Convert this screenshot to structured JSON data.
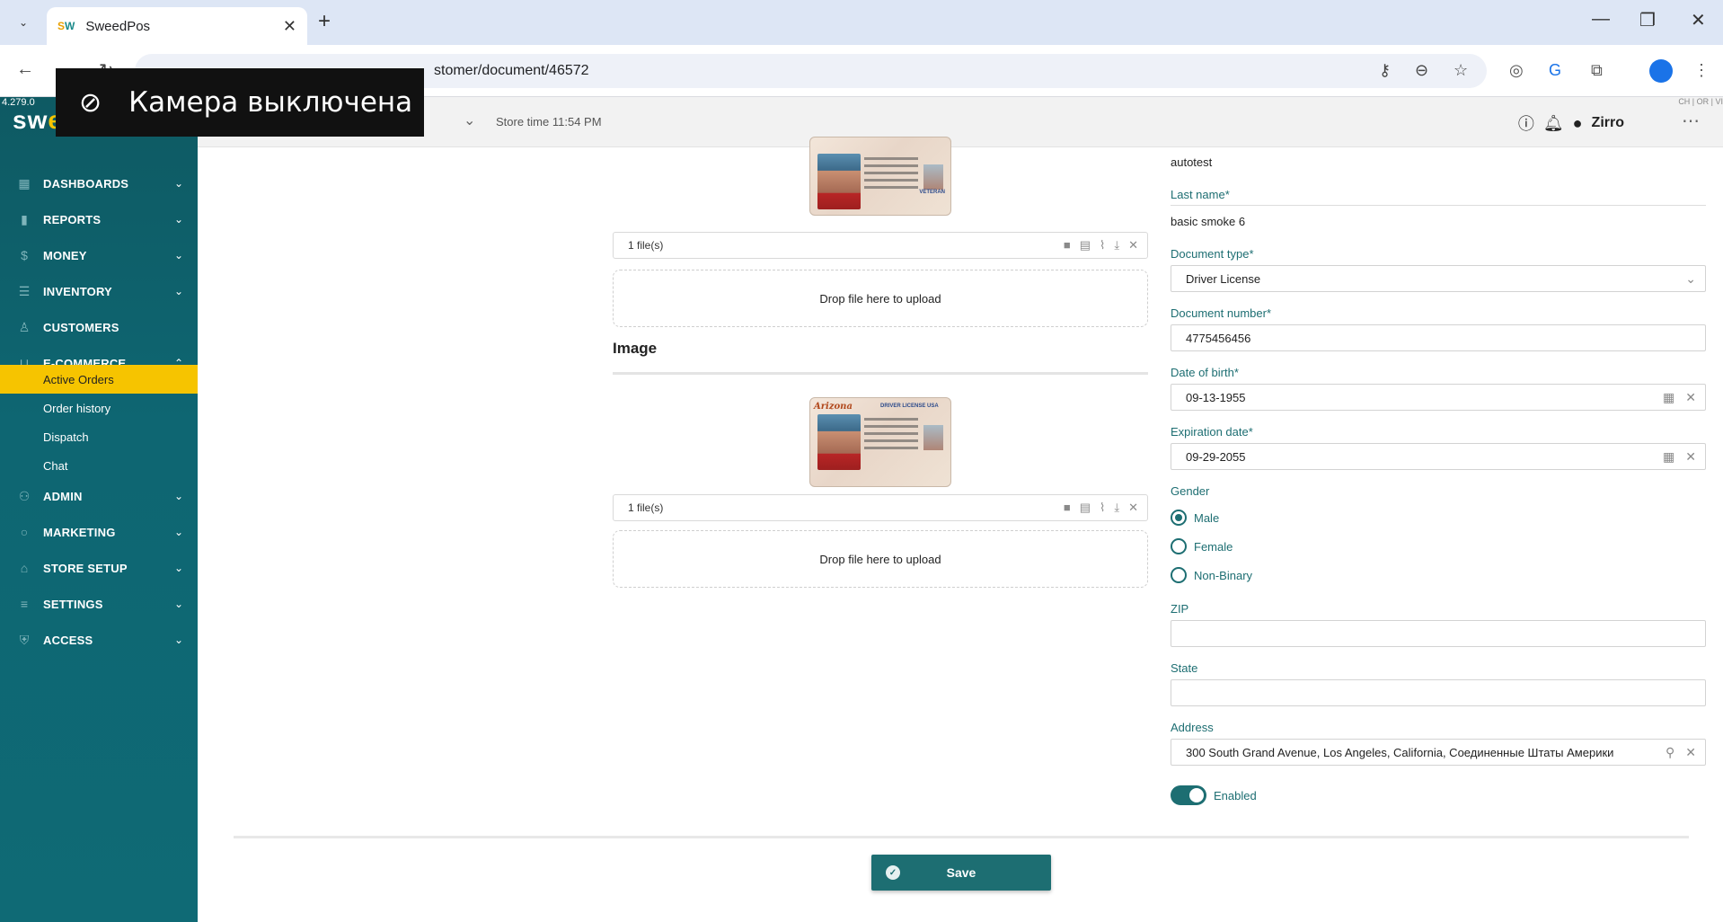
{
  "browser": {
    "tab_title": "SweedPos",
    "tab_favicon": "SW",
    "url": "stomer/document/46572",
    "camera_overlay": "Камера выключена"
  },
  "app": {
    "version": "4.279.0",
    "corner_tag": "CH | OR | VI",
    "logo": "sweed",
    "store_time": "Store time 11:54 PM",
    "user_name": "Zirro"
  },
  "sidebar": {
    "items": [
      {
        "label": "DASHBOARDS",
        "icon": "grid-icon"
      },
      {
        "label": "REPORTS",
        "icon": "bar-chart-icon"
      },
      {
        "label": "MONEY",
        "icon": "dollar-icon"
      },
      {
        "label": "INVENTORY",
        "icon": "list-icon"
      },
      {
        "label": "CUSTOMERS",
        "icon": "person-icon"
      },
      {
        "label": "E-COMMERCE",
        "icon": "basket-icon"
      },
      {
        "label": "ADMIN",
        "icon": "users-icon"
      },
      {
        "label": "MARKETING",
        "icon": "search-icon"
      },
      {
        "label": "STORE SETUP",
        "icon": "home-icon"
      },
      {
        "label": "SETTINGS",
        "icon": "sliders-icon"
      },
      {
        "label": "ACCESS",
        "icon": "shield-icon"
      }
    ],
    "ecommerce_sub": [
      {
        "label": "Active Orders"
      },
      {
        "label": "Order history"
      },
      {
        "label": "Dispatch"
      },
      {
        "label": "Chat"
      }
    ]
  },
  "images": {
    "card1_file_count": "1 file(s)",
    "card1_drop": "Drop file here to upload",
    "section_title": "Image",
    "card2_file_count": "1 file(s)",
    "card2_drop": "Drop file here to upload",
    "license_state": "Arizona",
    "license_type": "DRIVER LICENSE  USA",
    "license_veteran": "VETERAN"
  },
  "form": {
    "first_name_value": "autotest",
    "last_name_label": "Last name",
    "last_name_value": "basic smoke 6",
    "doc_type_label": "Document type",
    "doc_type_value": "Driver License",
    "doc_number_label": "Document number",
    "doc_number_value": "4775456456",
    "dob_label": "Date of birth",
    "dob_value": "09-13-1955",
    "exp_label": "Expiration date",
    "exp_value": "09-29-2055",
    "gender_label": "Gender",
    "gender_options": [
      "Male",
      "Female",
      "Non-Binary"
    ],
    "gender_selected": "Male",
    "zip_label": "ZIP",
    "zip_value": "",
    "state_label": "State",
    "state_value": "",
    "address_label": "Address",
    "address_value": "300 South Grand Avenue, Los Angeles, California, Соединенные Штаты Америки",
    "enabled_label": "Enabled",
    "enabled": true,
    "required_mark": "*"
  },
  "actions": {
    "save_label": "Save"
  },
  "colors": {
    "accent": "#1d6e72",
    "sidebar_active": "#f6c400"
  }
}
